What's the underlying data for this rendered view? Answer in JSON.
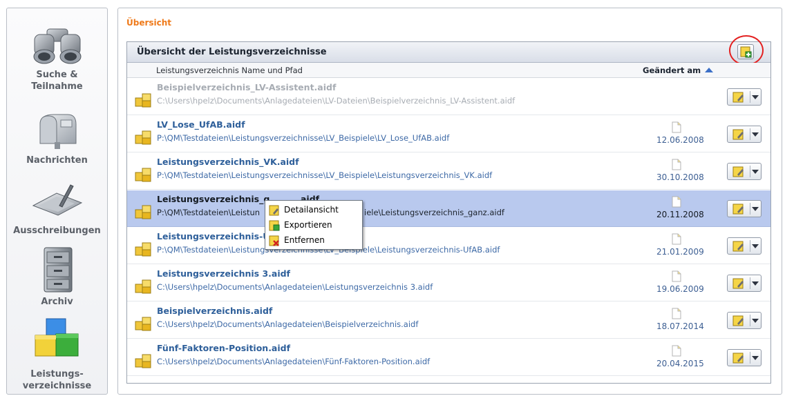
{
  "sidebar": {
    "items": [
      {
        "label": "Suche &\nTeilnahme",
        "icon": "binoculars-icon"
      },
      {
        "label": "Nachrichten",
        "icon": "mailbox-icon"
      },
      {
        "label": "Ausschreibungen",
        "icon": "tablet-pen-icon"
      },
      {
        "label": "Archiv",
        "icon": "file-cabinet-icon"
      },
      {
        "label": "Leistungs-\nverzeichnisse",
        "icon": "colored-blocks-icon"
      }
    ]
  },
  "main": {
    "page_title": "Übersicht",
    "table": {
      "title": "Übersicht der Leistungsverzeichnisse",
      "col_name": "Leistungsverzeichnis Name und Pfad",
      "col_date": "Geändert am",
      "rows": [
        {
          "name": "Beispielverzeichnis_LV-Assistent.aidf",
          "path": "C:\\Users\\hpelz\\Documents\\Anlagedateien\\LV-Dateien\\Beispielverzeichnis_LV-Assistent.aidf",
          "date": ""
        },
        {
          "name": "LV_Lose_UfAB.aidf",
          "path": "P:\\QM\\Testdateien\\Leistungsverzeichnisse\\LV_Beispiele\\LV_Lose_UfAB.aidf",
          "date": "12.06.2008"
        },
        {
          "name": "Leistungsverzeichnis_VK.aidf",
          "path": "P:\\QM\\Testdateien\\Leistungsverzeichnisse\\LV_Beispiele\\Leistungsverzeichnis_VK.aidf",
          "date": "30.10.2008"
        },
        {
          "name": "Leistungsverzeichnis_g",
          "name_tail": "aidf",
          "path": "P:\\QM\\Testdateien\\Leistun",
          "path_tail": "iele\\Leistungsverzeichnis_ganz.aidf",
          "date": "20.11.2008"
        },
        {
          "name": "Leistungsverzeichnis-U",
          "path": "P:\\QM\\Testdateien\\Leistungsverzeichnisse\\LV_Beispiele\\Leistungsverzeichnis-UfAB.aidf",
          "date": "21.01.2009"
        },
        {
          "name": "Leistungsverzeichnis 3.aidf",
          "path": "C:\\Users\\hpelz\\Documents\\Anlagedateien\\Leistungsverzeichnis 3.aidf",
          "date": "19.06.2009"
        },
        {
          "name": "Beispielverzeichnis.aidf",
          "path": "C:\\Users\\hpelz\\Documents\\Anlagedateien\\Beispielverzeichnis.aidf",
          "date": "18.07.2014"
        },
        {
          "name": "Fünf-Faktoren-Position.aidf",
          "path": "C:\\Users\\hpelz\\Documents\\Anlagedateien\\Fünf-Faktoren-Position.aidf",
          "date": "20.04.2015"
        }
      ]
    }
  },
  "context_menu": {
    "items": [
      {
        "label": "Detailansicht",
        "icon": "detail-view-icon"
      },
      {
        "label": "Exportieren",
        "icon": "export-icon"
      },
      {
        "label": "Entfernen",
        "icon": "remove-icon"
      }
    ]
  },
  "colors": {
    "accent_orange": "#ef7a1a",
    "link_blue": "#2e5f9a",
    "selected_row": "#b9c9ee",
    "highlight_ring": "#e32020"
  }
}
